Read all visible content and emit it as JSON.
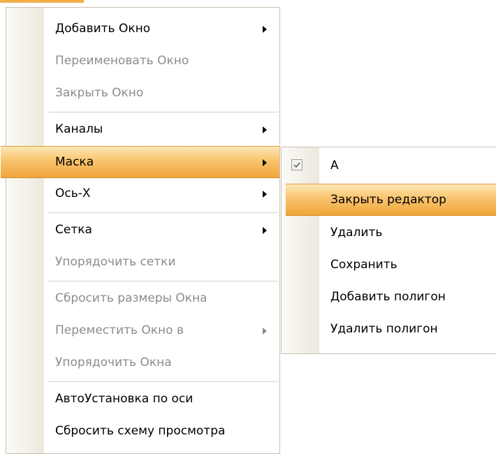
{
  "main_menu": {
    "items": [
      {
        "label": "Добавить Окно",
        "enabled": true,
        "submenu": true
      },
      {
        "label": "Переименовать Окно",
        "enabled": false,
        "submenu": false
      },
      {
        "label": "Закрыть Окно",
        "enabled": false,
        "submenu": false
      },
      {
        "label": "Каналы",
        "enabled": true,
        "submenu": true
      },
      {
        "label": "Маска",
        "enabled": true,
        "submenu": true,
        "highlighted": true
      },
      {
        "label": "Ось-X",
        "enabled": true,
        "submenu": true
      },
      {
        "label": "Сетка",
        "enabled": true,
        "submenu": true
      },
      {
        "label": "Упорядочить сетки",
        "enabled": false,
        "submenu": false
      },
      {
        "label": "Сбросить размеры Окна",
        "enabled": false,
        "submenu": false
      },
      {
        "label": "Переместить Окно в",
        "enabled": false,
        "submenu": true
      },
      {
        "label": "Упорядочить Окна",
        "enabled": false,
        "submenu": false
      },
      {
        "label": "АвтоУстановка по оси",
        "enabled": true,
        "submenu": false
      },
      {
        "label": "Сбросить схему просмотра",
        "enabled": true,
        "submenu": false
      }
    ]
  },
  "submenu": {
    "parent": "Маска",
    "items": [
      {
        "label": "A",
        "checked": true
      },
      {
        "label": "Закрыть редактор",
        "highlighted": true
      },
      {
        "label": "Удалить"
      },
      {
        "label": "Сохранить"
      },
      {
        "label": "Добавить полигон"
      },
      {
        "label": "Удалить полигон"
      }
    ]
  },
  "colors": {
    "highlight": "#f9c46e",
    "disabled_text": "#8c8c8c",
    "border": "#c9c1b2"
  }
}
